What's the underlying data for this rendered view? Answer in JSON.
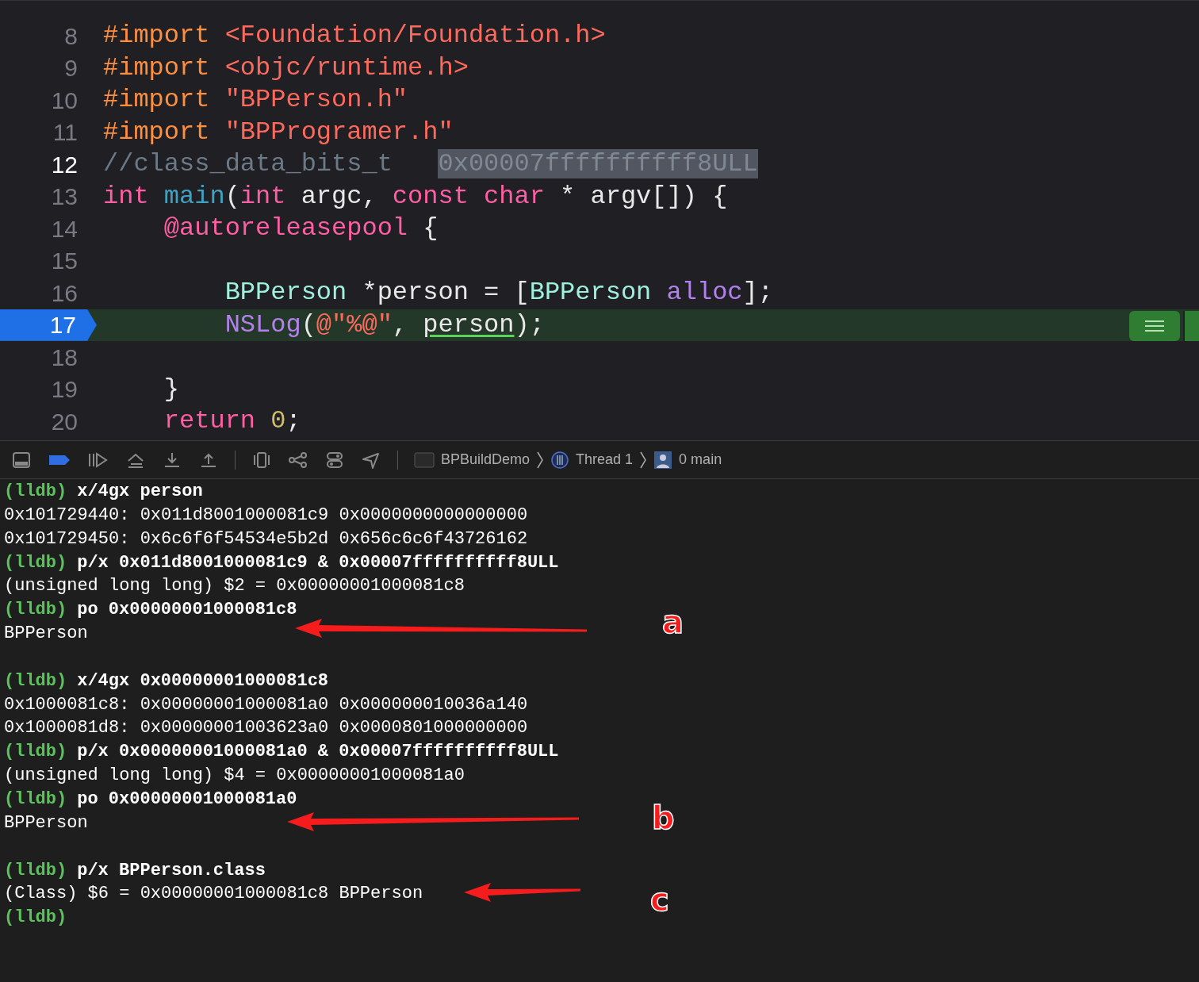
{
  "editor": {
    "lines": [
      {
        "number": "8",
        "current": false,
        "tokens": [
          {
            "kind": "preproc",
            "text": "#import "
          },
          {
            "kind": "string",
            "text": "<Foundation/Foundation.h>"
          }
        ]
      },
      {
        "number": "9",
        "current": false,
        "tokens": [
          {
            "kind": "preproc",
            "text": "#import "
          },
          {
            "kind": "string",
            "text": "<objc/runtime.h>"
          }
        ]
      },
      {
        "number": "10",
        "current": false,
        "tokens": [
          {
            "kind": "preproc",
            "text": "#import "
          },
          {
            "kind": "string",
            "text": "\"BPPerson.h\""
          }
        ]
      },
      {
        "number": "11",
        "current": false,
        "tokens": [
          {
            "kind": "preproc",
            "text": "#import "
          },
          {
            "kind": "string",
            "text": "\"BPProgramer.h\""
          }
        ]
      },
      {
        "number": "12",
        "current": false,
        "tokens": [
          {
            "kind": "comment",
            "text": "//class_data_bits_t   "
          },
          {
            "kind": "selection",
            "text": "0x00007ffffffffff8ULL"
          }
        ]
      },
      {
        "number": "13",
        "current": false,
        "tokens": [
          {
            "kind": "keyword",
            "text": "int "
          },
          {
            "kind": "function",
            "text": "main"
          },
          {
            "kind": "plain",
            "text": "("
          },
          {
            "kind": "keyword",
            "text": "int "
          },
          {
            "kind": "plain",
            "text": "argc, "
          },
          {
            "kind": "keyword",
            "text": "const char "
          },
          {
            "kind": "plain",
            "text": "* argv[]) {"
          }
        ]
      },
      {
        "number": "14",
        "current": false,
        "tokens": [
          {
            "kind": "keyword",
            "text": "    @autoreleasepool "
          },
          {
            "kind": "plain",
            "text": "{"
          }
        ]
      },
      {
        "number": "15",
        "current": false
      },
      {
        "number": "16",
        "current": false,
        "tokens": [
          {
            "kind": "class",
            "text": "        BPPerson "
          },
          {
            "kind": "plain",
            "text": "*person = ["
          },
          {
            "kind": "class",
            "text": "BPPerson "
          },
          {
            "kind": "method",
            "text": "alloc"
          },
          {
            "kind": "plain",
            "text": "];"
          }
        ]
      },
      {
        "number": "17",
        "current": true,
        "tokens": [
          {
            "kind": "method",
            "text": "        NSLog"
          },
          {
            "kind": "plain",
            "text": "("
          },
          {
            "kind": "string",
            "text": "@\"%@\""
          },
          {
            "kind": "plain",
            "text": ", "
          },
          {
            "kind": "variable",
            "text": "person"
          },
          {
            "kind": "plain",
            "text": ");"
          }
        ]
      },
      {
        "number": "18",
        "current": false
      },
      {
        "number": "19",
        "current": false,
        "tokens": [
          {
            "kind": "plain",
            "text": "    }"
          }
        ]
      },
      {
        "number": "20",
        "current": false,
        "tokens": [
          {
            "kind": "keyword",
            "text": "    return "
          },
          {
            "kind": "number",
            "text": "0"
          },
          {
            "kind": "plain",
            "text": ";"
          }
        ]
      }
    ]
  },
  "debug_bar": {
    "breadcrumbs": [
      "BPBuildDemo",
      "Thread 1",
      "0 main"
    ]
  },
  "console": {
    "lines": [
      {
        "kind": "prompt",
        "prompt": "(lldb)",
        "command": "x/4gx person"
      },
      {
        "kind": "output",
        "text": "0x101729440: 0x011d8001000081c9 0x0000000000000000"
      },
      {
        "kind": "output",
        "text": "0x101729450: 0x6c6f6f54534e5b2d 0x656c6c6f43726162"
      },
      {
        "kind": "prompt",
        "prompt": "(lldb)",
        "command": "p/x 0x011d8001000081c9 & 0x00007ffffffffff8ULL"
      },
      {
        "kind": "output",
        "text": "(unsigned long long) $2 = 0x00000001000081c8"
      },
      {
        "kind": "prompt",
        "prompt": "(lldb)",
        "command": "po 0x00000001000081c8"
      },
      {
        "kind": "output",
        "text": "BPPerson"
      },
      {
        "kind": "blank"
      },
      {
        "kind": "prompt",
        "prompt": "(lldb)",
        "command": "x/4gx 0x00000001000081c8"
      },
      {
        "kind": "output",
        "text": "0x1000081c8: 0x00000001000081a0 0x000000010036a140"
      },
      {
        "kind": "output",
        "text": "0x1000081d8: 0x00000001003623a0 0x0000801000000000"
      },
      {
        "kind": "prompt",
        "prompt": "(lldb)",
        "command": "p/x 0x00000001000081a0 & 0x00007ffffffffff8ULL"
      },
      {
        "kind": "output",
        "text": "(unsigned long long) $4 = 0x00000001000081a0"
      },
      {
        "kind": "prompt",
        "prompt": "(lldb)",
        "command": "po 0x00000001000081a0"
      },
      {
        "kind": "output",
        "text": "BPPerson"
      },
      {
        "kind": "blank"
      },
      {
        "kind": "prompt",
        "prompt": "(lldb)",
        "command": "p/x BPPerson.class"
      },
      {
        "kind": "output",
        "text": "(Class) $6 = 0x00000001000081c8 BPPerson"
      },
      {
        "kind": "prompt",
        "prompt": "(lldb)"
      }
    ]
  },
  "annotations": [
    {
      "label": "a"
    },
    {
      "label": "b"
    },
    {
      "label": "c"
    }
  ]
}
